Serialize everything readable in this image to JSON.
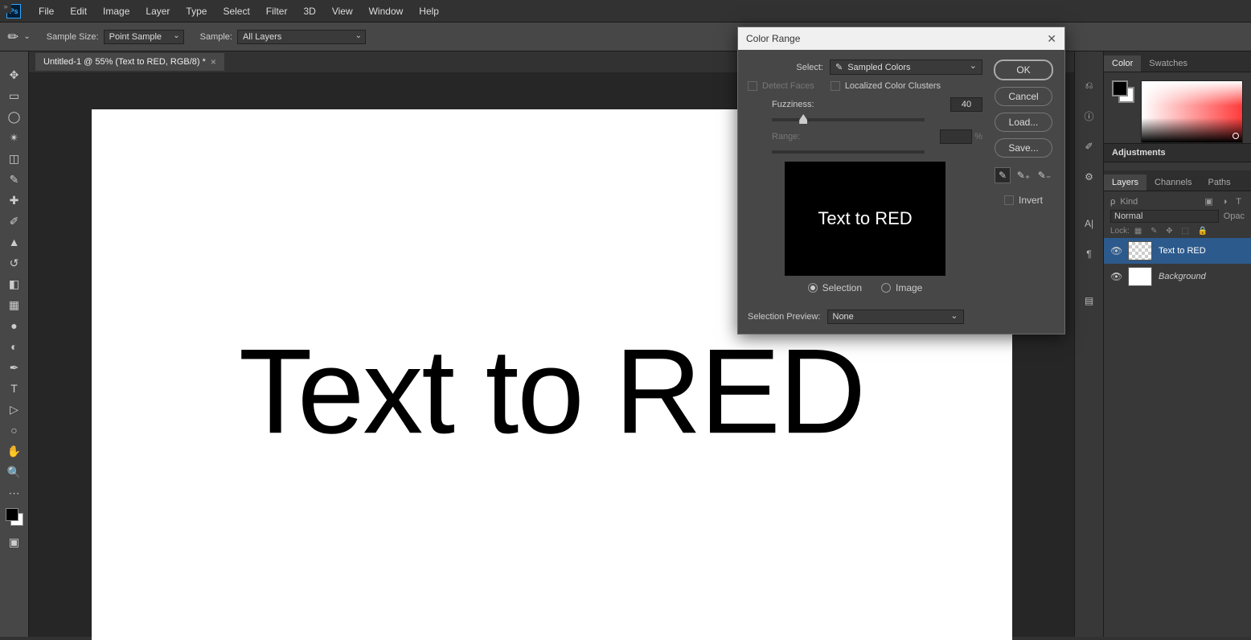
{
  "menu": {
    "items": [
      "File",
      "Edit",
      "Image",
      "Layer",
      "Type",
      "Select",
      "Filter",
      "3D",
      "View",
      "Window",
      "Help"
    ]
  },
  "options": {
    "sample_size_label": "Sample Size:",
    "sample_size_value": "Point Sample",
    "sample_label": "Sample:",
    "sample_value": "All Layers"
  },
  "doc": {
    "tab_title": "Untitled-1 @ 55% (Text to RED, RGB/8) *",
    "canvas_text": "Text to RED"
  },
  "colorrange": {
    "title": "Color Range",
    "select_label": "Select:",
    "select_value": "Sampled Colors",
    "detect_faces": "Detect Faces",
    "localized": "Localized Color Clusters",
    "fuzziness_label": "Fuzziness:",
    "fuzziness_value": "40",
    "range_label": "Range:",
    "range_unit": "%",
    "preview_text": "Text to RED",
    "radio_selection": "Selection",
    "radio_image": "Image",
    "selection_preview_label": "Selection Preview:",
    "selection_preview_value": "None",
    "btn_ok": "OK",
    "btn_cancel": "Cancel",
    "btn_load": "Load...",
    "btn_save": "Save...",
    "invert_label": "Invert"
  },
  "panels": {
    "color_tab": "Color",
    "swatches_tab": "Swatches",
    "adjustments_title": "Adjustments",
    "layers_tab": "Layers",
    "channels_tab": "Channels",
    "paths_tab": "Paths",
    "kind_label": "Kind",
    "blend_mode": "Normal",
    "opacity_label": "Opac",
    "lock_label": "Lock:",
    "layer1_name": "Text to RED",
    "layer2_name": "Background"
  }
}
